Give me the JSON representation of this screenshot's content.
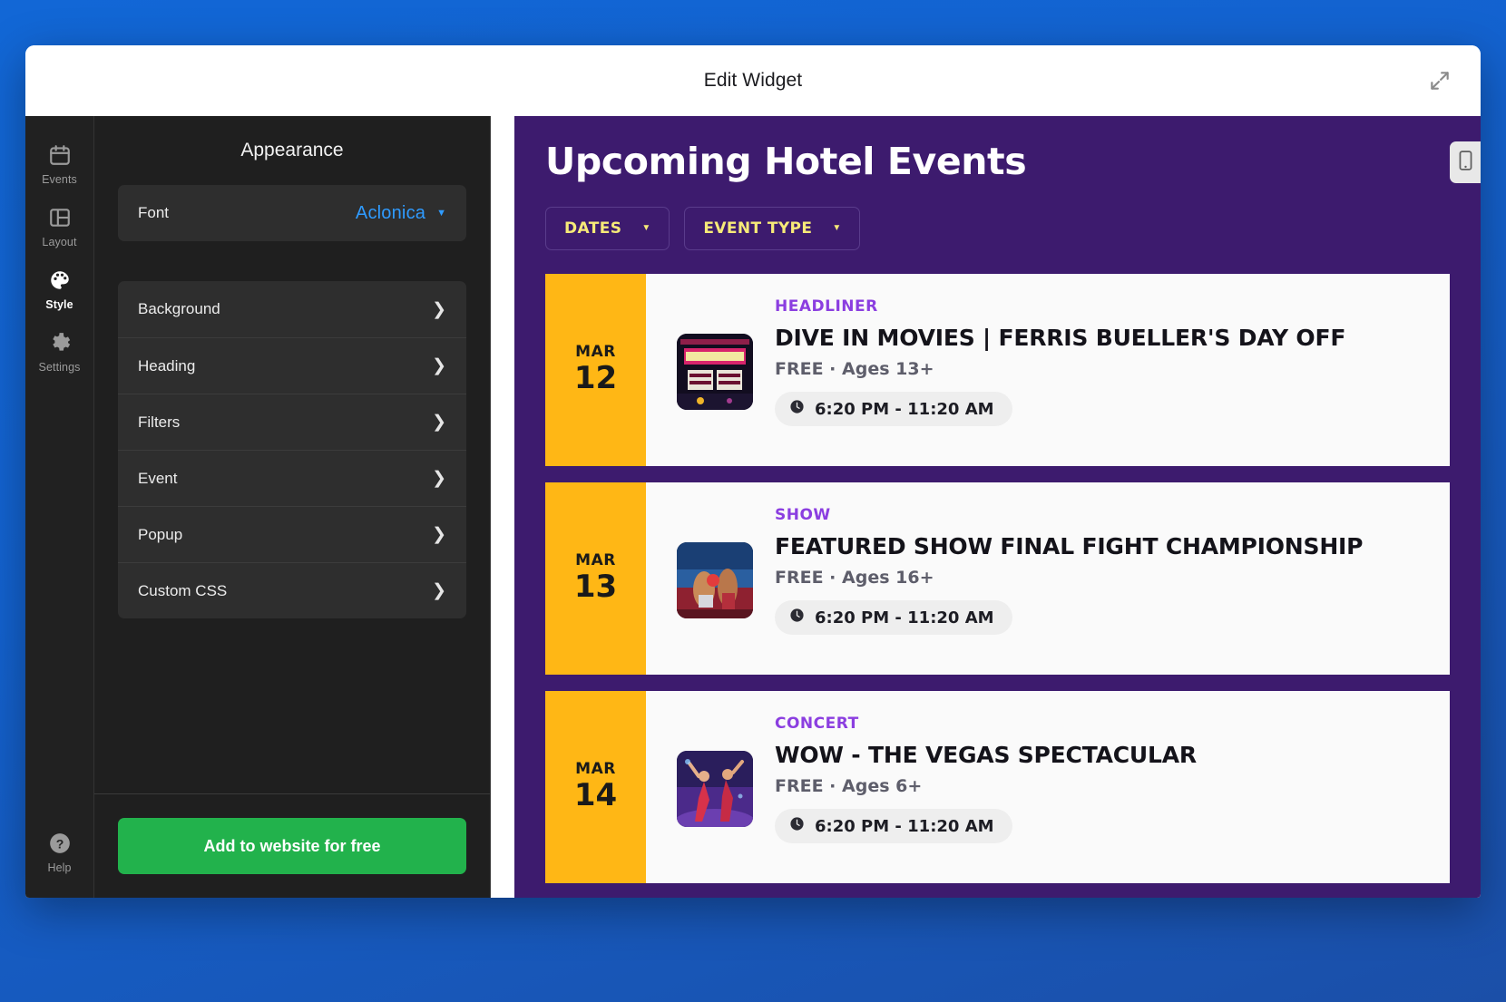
{
  "window": {
    "title": "Edit Widget",
    "expand_icon": "expand-arrows-icon"
  },
  "rail": {
    "items": [
      {
        "label": "Events",
        "icon": "calendar-icon",
        "active": false
      },
      {
        "label": "Layout",
        "icon": "layout-icon",
        "active": false
      },
      {
        "label": "Style",
        "icon": "palette-icon",
        "active": true
      },
      {
        "label": "Settings",
        "icon": "gear-icon",
        "active": false
      }
    ],
    "help": {
      "label": "Help",
      "icon": "question-circle-icon"
    }
  },
  "panel": {
    "title": "Appearance",
    "font_row": {
      "label": "Font",
      "value": "Aclonica",
      "caret": "chevron-down-icon"
    },
    "sections": [
      {
        "label": "Background"
      },
      {
        "label": "Heading"
      },
      {
        "label": "Filters"
      },
      {
        "label": "Event"
      },
      {
        "label": "Popup"
      },
      {
        "label": "Custom CSS"
      }
    ],
    "cta_label": "Add to website for free",
    "cta_color": "#22b24c"
  },
  "preview": {
    "device_toggle_icon": "mobile-phone-icon",
    "background_color": "#3d1b6e",
    "heading": "Upcoming Hotel Events",
    "heading_color": "#ffffff",
    "accent_date_color": "#ffb715",
    "filter_text_color": "#f7ea78",
    "category_color": "#8b3ee0",
    "filters": [
      {
        "label": "DATES",
        "caret": "chevron-down-icon"
      },
      {
        "label": "EVENT TYPE",
        "caret": "chevron-down-icon"
      }
    ],
    "events": [
      {
        "month": "MAR",
        "day": "12",
        "category": "HEADLINER",
        "name": "DIVE IN MOVIES | FERRIS BUELLER'S DAY OFF",
        "meta": "FREE  ·  Ages 13+",
        "time": "6:20 PM - 11:20 AM",
        "time_icon": "clock-icon",
        "thumb": "movie-theater-marquee-photo"
      },
      {
        "month": "MAR",
        "day": "13",
        "category": "SHOW",
        "name": "FEATURED SHOW FINAL FIGHT CHAMPIONSHIP",
        "meta": "FREE  ·  Ages 16+",
        "time": "6:20 PM - 11:20 AM",
        "time_icon": "clock-icon",
        "thumb": "boxing-match-photo"
      },
      {
        "month": "MAR",
        "day": "14",
        "category": "CONCERT",
        "name": "WOW - THE VEGAS SPECTACULAR",
        "meta": "FREE  ·  Ages 6+",
        "time": "6:20 PM - 11:20 AM",
        "time_icon": "clock-icon",
        "thumb": "stage-dancers-photo"
      }
    ]
  }
}
